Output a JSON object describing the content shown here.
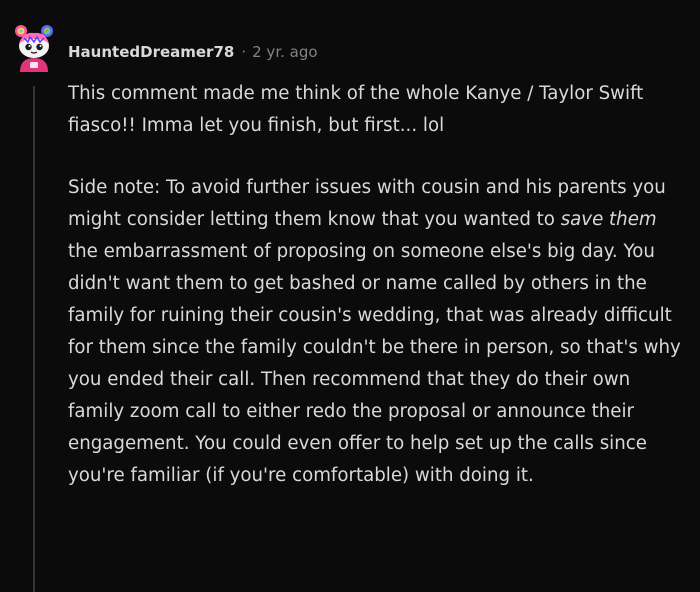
{
  "comment": {
    "author": "HauntedDreamer78",
    "separator": "·",
    "age": "2 yr. ago",
    "paragraph1": "This comment made me think of the whole Kanye / Taylor Swift fiasco!! Imma let you finish, but first... lol",
    "paragraph2": {
      "before": "Side note: To avoid further issues with cousin and his parents you might consider letting them know that you wanted to ",
      "emphasis": "save them",
      "after": " the embarrassment of proposing on someone else's big day. You didn't want them to get bashed or name called by others in the family for ruining their cousin's wedding, that was already difficult for them since the family couldn't be there in person, so that's why you ended their call. Then recommend that they do their own family zoom call to either redo the proposal or announce their engagement. You could even offer to help set up the calls since you're familiar (if you're comfortable) with doing it."
    }
  },
  "colors": {
    "background": "#0b0b0b",
    "text": "#d7dadc",
    "meta": "#818384",
    "thread_line": "#343536"
  },
  "icons": {
    "avatar": "snoo-avatar-icon"
  }
}
